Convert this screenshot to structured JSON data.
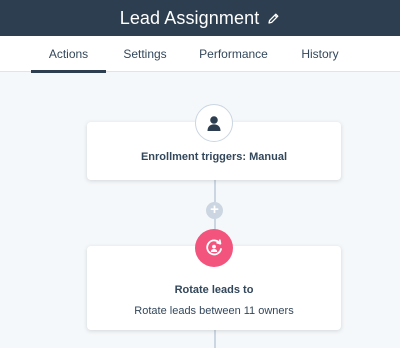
{
  "header": {
    "title": "Lead Assignment",
    "edit_icon": "pencil-icon"
  },
  "tabs": [
    {
      "label": "Actions",
      "active": true
    },
    {
      "label": "Settings",
      "active": false
    },
    {
      "label": "Performance",
      "active": false
    },
    {
      "label": "History",
      "active": false
    }
  ],
  "workflow": {
    "trigger": {
      "icon": "user-icon",
      "title": "Enrollment triggers: Manual"
    },
    "add_icon": "plus-icon",
    "action": {
      "icon": "rotate-icon",
      "title": "Rotate leads to",
      "subtitle": "Rotate leads between 11 owners"
    }
  },
  "colors": {
    "header_bg": "#2d3e50",
    "accent": "#f2547d",
    "canvas_bg": "#f5f8fa",
    "connector": "#cbd6e2",
    "text": "#33475b"
  }
}
